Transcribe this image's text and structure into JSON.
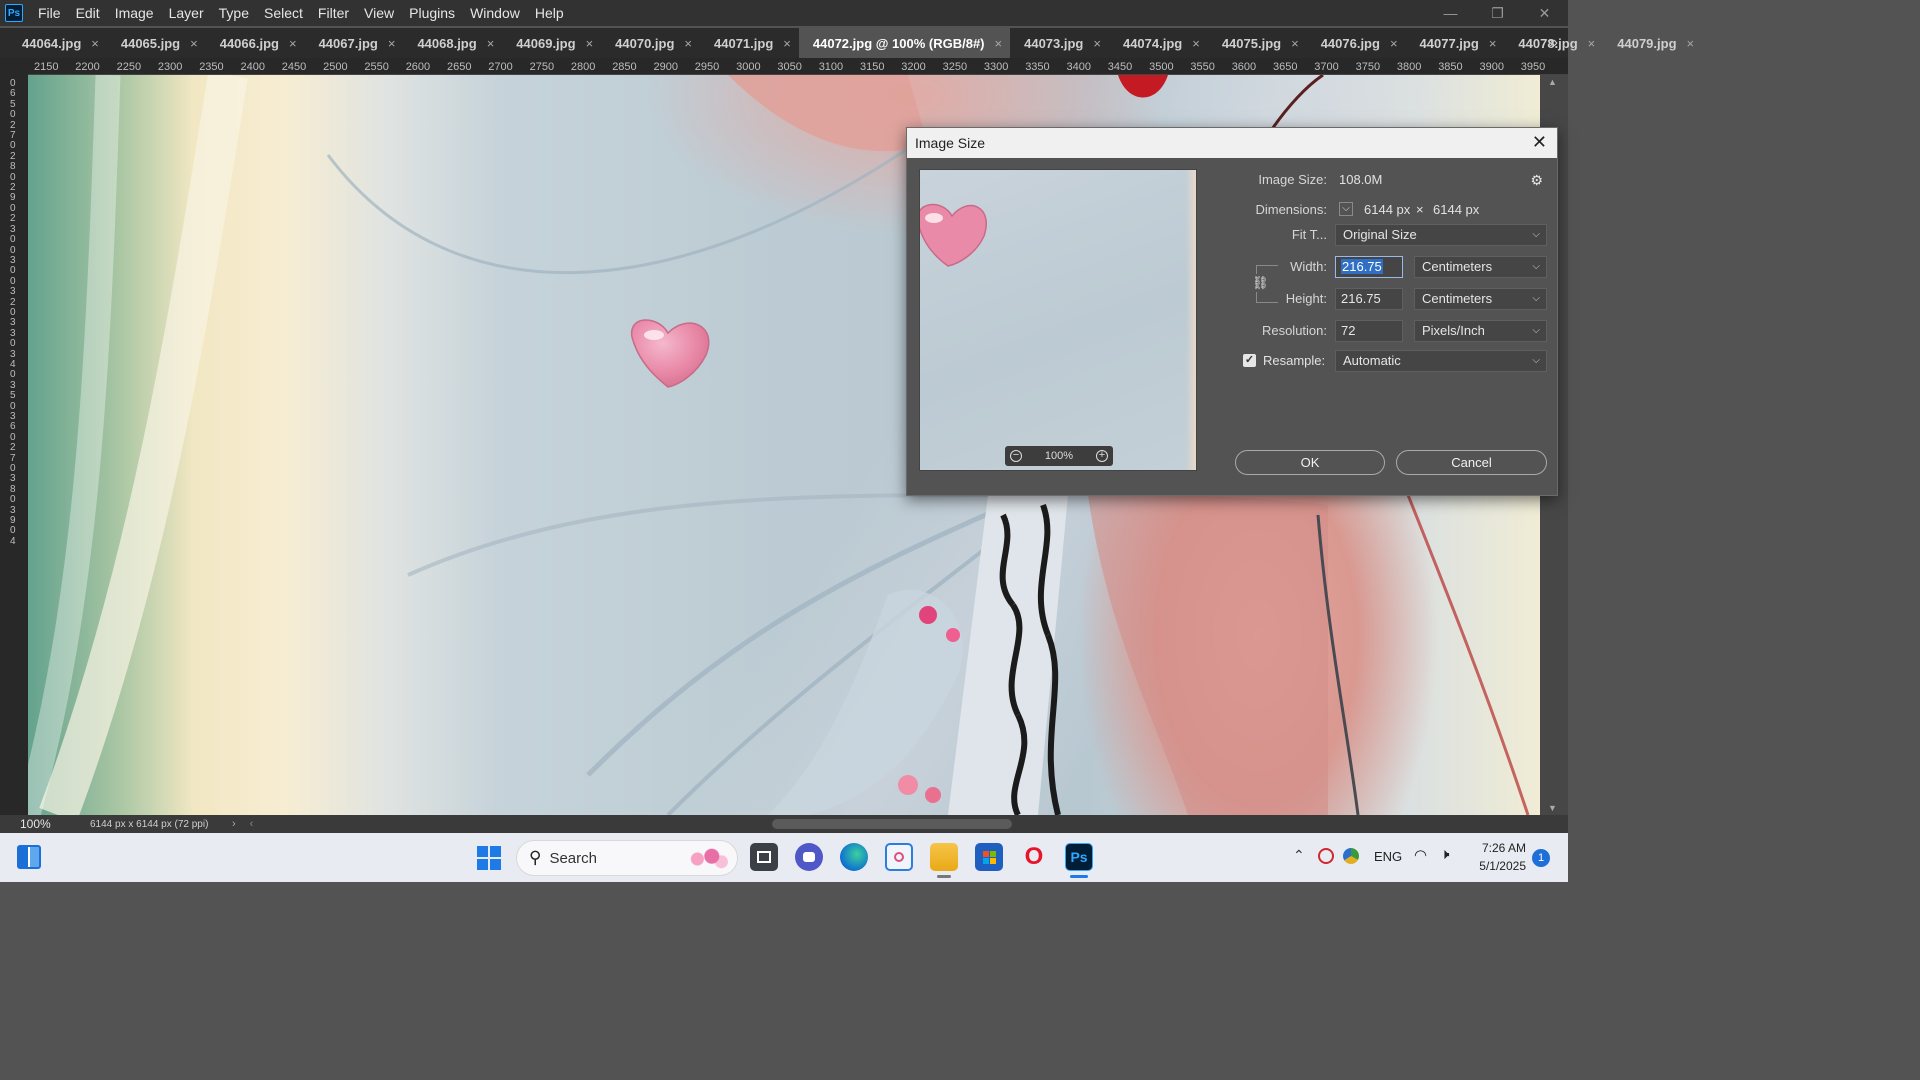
{
  "app": {
    "logo": "Ps"
  },
  "menu": [
    "File",
    "Edit",
    "Image",
    "Layer",
    "Type",
    "Select",
    "Filter",
    "View",
    "Plugins",
    "Window",
    "Help"
  ],
  "window_controls": {
    "minimize": "—",
    "restore": "❐",
    "close": "✕"
  },
  "tabs": [
    {
      "label": "44064.jpg"
    },
    {
      "label": "44065.jpg"
    },
    {
      "label": "44066.jpg"
    },
    {
      "label": "44067.jpg"
    },
    {
      "label": "44068.jpg"
    },
    {
      "label": "44069.jpg"
    },
    {
      "label": "44070.jpg"
    },
    {
      "label": "44071.jpg"
    },
    {
      "label": "44072.jpg @ 100% (RGB/8#)",
      "active": true
    },
    {
      "label": "44073.jpg"
    },
    {
      "label": "44074.jpg"
    },
    {
      "label": "44075.jpg"
    },
    {
      "label": "44076.jpg"
    },
    {
      "label": "44077.jpg"
    },
    {
      "label": "44078.jpg"
    },
    {
      "label": "44079.jpg"
    }
  ],
  "tab_close_glyph": "×",
  "tab_overflow": "»",
  "ruler_h": [
    "2150",
    "2200",
    "2250",
    "2300",
    "2350",
    "2400",
    "2450",
    "2500",
    "2550",
    "2600",
    "2650",
    "2700",
    "2750",
    "2800",
    "2850",
    "2900",
    "2950",
    "3000",
    "3050",
    "3100",
    "3150",
    "3200",
    "3250",
    "3300",
    "3350",
    "3400",
    "3450",
    "3500",
    "3550",
    "3600",
    "3650",
    "3700",
    "3750",
    "3800",
    "3850",
    "3900",
    "3950"
  ],
  "ruler_v_text": "065027028029023003003203303403503602703803904",
  "status": {
    "zoom": "100%",
    "doc_info": "6144 px x 6144 px (72 ppi)",
    "arrow": "›",
    "prev": "‹"
  },
  "dialog": {
    "title": "Image Size",
    "close": "✕",
    "image_size_label": "Image Size:",
    "image_size_value": "108.0M",
    "dimensions_label": "Dimensions:",
    "dim_width": "6144 px",
    "dim_times": "×",
    "dim_height": "6144 px",
    "fit_to_label": "Fit T...",
    "fit_to_value": "Original Size",
    "width_label": "Width:",
    "width_value": "216.75",
    "width_unit": "Centimeters",
    "height_label": "Height:",
    "height_value": "216.75",
    "height_unit": "Centimeters",
    "resolution_label": "Resolution:",
    "resolution_value": "72",
    "resolution_unit": "Pixels/Inch",
    "resample_label": "Resample:",
    "resample_value": "Automatic",
    "resample_checked": true,
    "preview_zoom": "100%",
    "ok_label": "OK",
    "cancel_label": "Cancel",
    "chevron": "⌵",
    "check": "✓",
    "gear": "⚙",
    "link": "⛓",
    "zoom_out": "−",
    "zoom_in": "+"
  },
  "taskbar": {
    "search_label": "Search",
    "search_icon": "⚲",
    "tray_chevron": "⌃",
    "language": "ENG",
    "wifi_icon": "◠",
    "volume_icon": "🕨",
    "time": "7:26 AM",
    "date": "5/1/2025",
    "notifications": "1",
    "photoshop_label": "Ps",
    "opera_label": "O",
    "colors": {
      "accent": "#1e7ae6",
      "photoshop": "#001e36",
      "photoshop_text": "#31a8ff",
      "opera": "#e8142a"
    }
  }
}
